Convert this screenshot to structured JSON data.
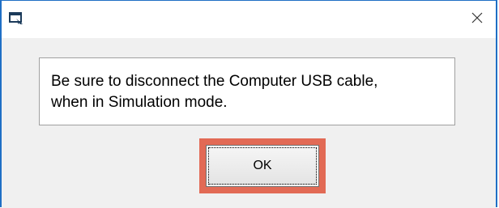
{
  "dialog": {
    "title": "",
    "icon": "app-window-icon",
    "close_icon": "close-icon",
    "message": "Be sure to disconnect the Computer USB cable,\nwhen in Simulation mode.",
    "ok_label": "OK"
  },
  "colors": {
    "window_border": "#1f6fc5",
    "highlight": "#e26a55",
    "client_background": "#f0f0f0"
  }
}
